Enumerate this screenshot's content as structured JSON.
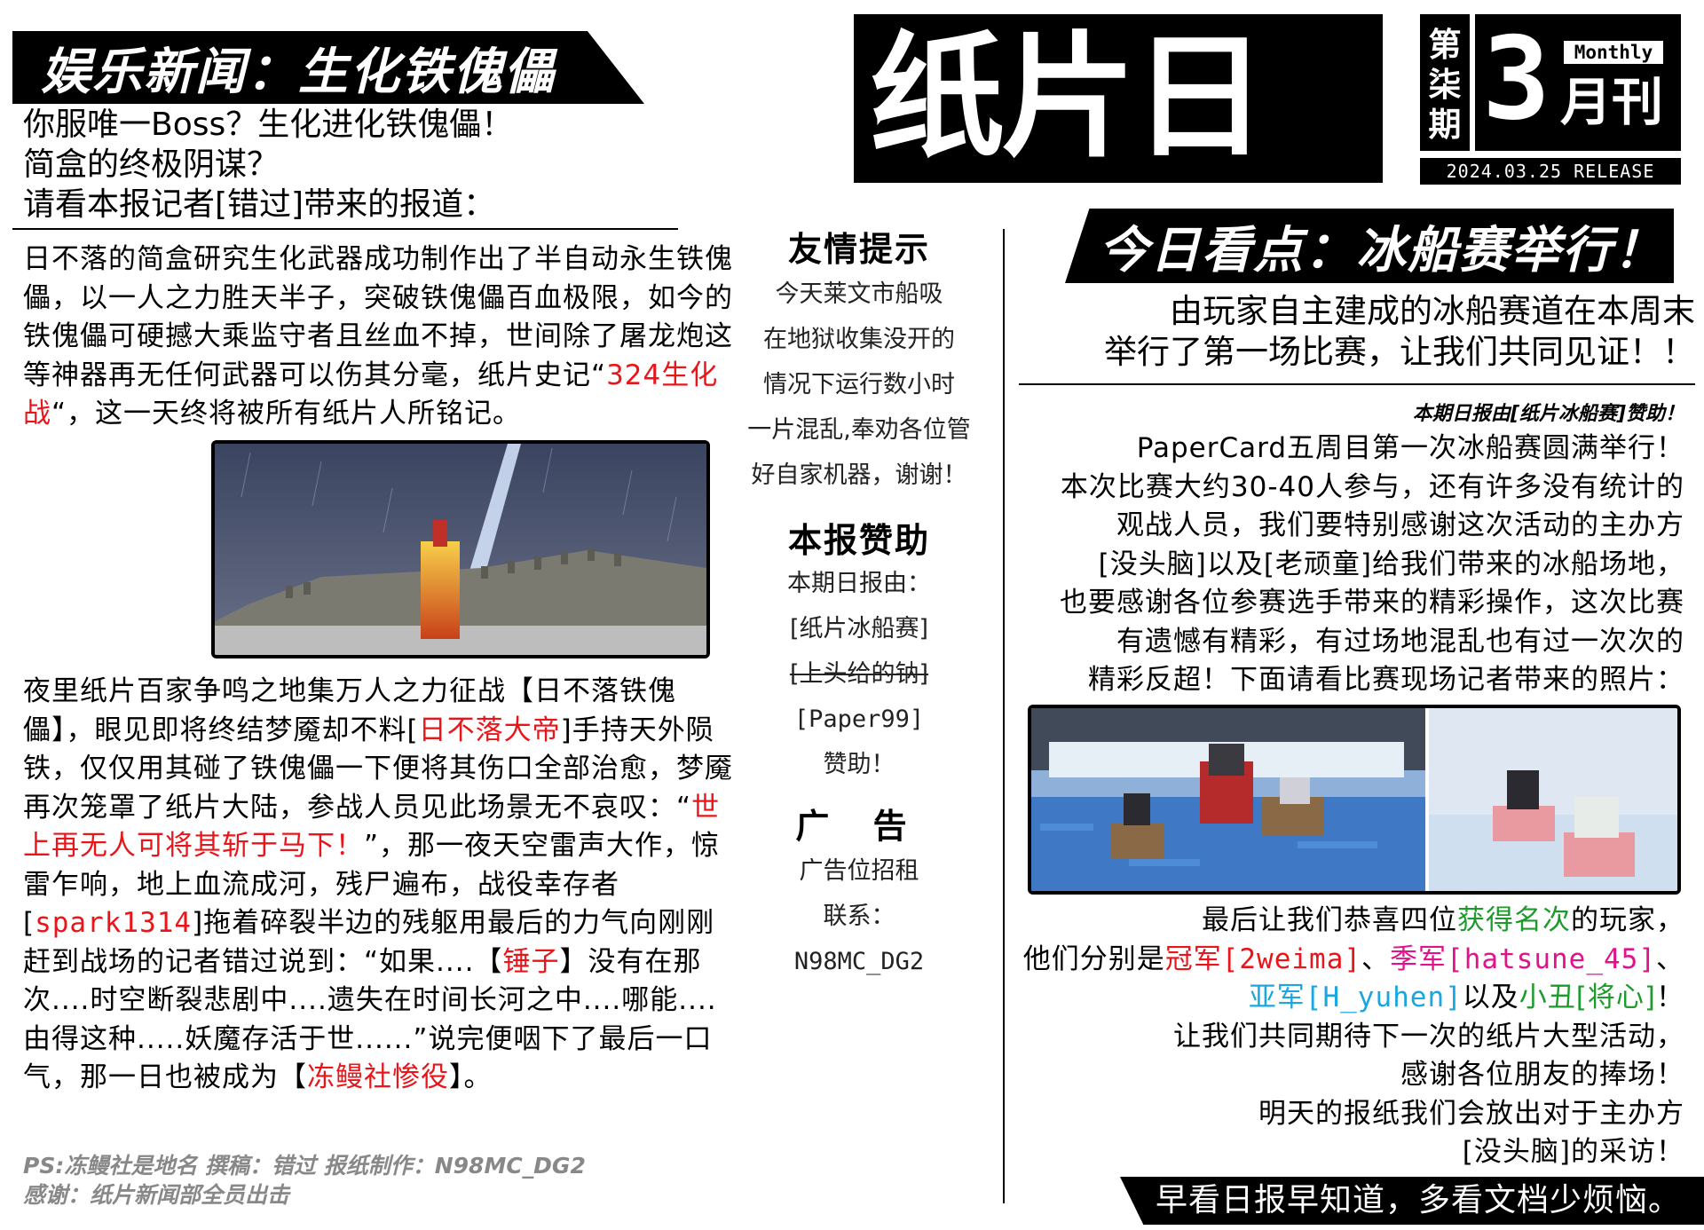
{
  "left": {
    "banner": "娱乐新闻：生化铁傀儡",
    "lead_lines": [
      "你服唯一Boss？生化进化铁傀儡！",
      "简盒的终极阴谋？",
      "请看本报记者[错过]带来的报道："
    ],
    "p1_a": "日不落的简盒研究生化武器成功制作出了半自动永生铁傀儡，以一人之力胜天半子，突破铁傀儡百血极限，如今的铁傀儡可硬撼大乘监守者且丝血不掉，世间除了屠龙炮这等神器再无任何武器可以伤其分毫，纸片史记“",
    "p1_red": "324生化战",
    "p1_b": "“，这一天终将被所有纸片人所铭记。",
    "p2_a": "夜里纸片百家争鸣之地集万人之力征战【日不落铁傀儡】，眼见即将终结梦魇却不料[",
    "p2_red1": "日不落大帝",
    "p2_b": "]手持天外陨铁，仅仅用其碰了铁傀儡一下便将其伤口全部治愈，梦魇再次笼罩了纸片大陆，参战人员见此场景无不哀叹：“",
    "p2_red2": "世上再无人可将其斩于马下！",
    "p2_c": "”，那一夜天空雷声大作，惊雷乍响，地上血流成河，残尸遍布，战役幸存者[",
    "p2_red3": "spark1314",
    "p2_d": "]拖着碎裂半边的残躯用最后的力气向刚刚赶到战场的记者错过说到：“如果....【",
    "p2_red4": "锤子",
    "p2_e": "】没有在那次....时空断裂悲剧中....遗失在时间长河之中....哪能....由得这种.....妖魔存活于世......”说完便咽下了最后一口气，那一日也被成为【",
    "p2_red5": "冻鳗社惨役",
    "p2_f": "】。",
    "ps_line1": "PS:冻鳗社是地名   撰稿：错过  报纸制作：N98MC_DG2",
    "ps_line2": "感谢：纸片新闻部全员出击"
  },
  "masthead": {
    "title": "纸片日报",
    "issue": [
      "第",
      "柒",
      "期"
    ],
    "number": "3",
    "monthly": "Monthly",
    "yuekan": "月刊",
    "release": "2024.03.25 RELEASE"
  },
  "middle": {
    "tip_title": "友情提示",
    "tip_lines": [
      "今天莱文市船吸",
      "在地狱收集没开的",
      "情况下运行数小时",
      "一片混乱,奉劝各位管",
      "好自家机器，谢谢！"
    ],
    "sponsor_title": "本报赞助",
    "sponsor_l1": "本期日报由：",
    "sponsor_l2": "[纸片冰船赛]",
    "sponsor_l3": "[上头给的钠]",
    "sponsor_l4": "[Paper99]",
    "sponsor_l5": "赞助！",
    "ad_title": "广 告",
    "ad_l1": "广告位招租",
    "ad_l2": "联系：",
    "ad_l3": "N98MC_DG2"
  },
  "right": {
    "banner": "今日看点：冰船赛举行！",
    "lead_lines": [
      "由玩家自主建成的冰船赛道在本周末",
      "举行了第一场比赛，让我们共同见证！！"
    ],
    "sponsor_note": "本期日报由[纸片冰船赛]赞助！",
    "p1_lines": [
      "PaperCard五周目第一次冰船赛圆满举行！",
      "本次比赛大约30-40人参与，还有许多没有统计的",
      "观战人员，我们要特别感谢这次活动的主办方",
      "[没头脑]以及[老顽童]给我们带来的冰船场地，",
      "也要感谢各位参赛选手带来的精彩操作，这次比赛",
      "有遗憾有精彩，有过场地混乱也有过一次次的",
      "精彩反超！下面请看比赛现场记者带来的照片："
    ],
    "c_l1a": "最后让我们恭喜四位",
    "c_l1g": "获得名次",
    "c_l1b": "的玩家，",
    "c_l2a": "他们分别是",
    "c_l2r": "冠军[2weima]",
    "c_l2sep": "、",
    "c_l2p": "季军[hatsune_45]",
    "c_l2end": "、",
    "c_l3c": "亚军[H_yuhen]",
    "c_l3a": "以及",
    "c_l3g": "小丑[将心]",
    "c_l3end": "！",
    "c_rest": [
      "让我们共同期待下一次的纸片大型活动，",
      "感谢各位朋友的捧场！",
      "明天的报纸我们会放出对于主办方",
      "[没头脑]的采访！"
    ],
    "footer": "早看日报早知道，多看文档少烦恼。"
  },
  "colors": {
    "accent_red": "#e8161b",
    "green": "#1e9a2c",
    "cyan": "#1aa7e0",
    "pink": "#e0138c"
  }
}
